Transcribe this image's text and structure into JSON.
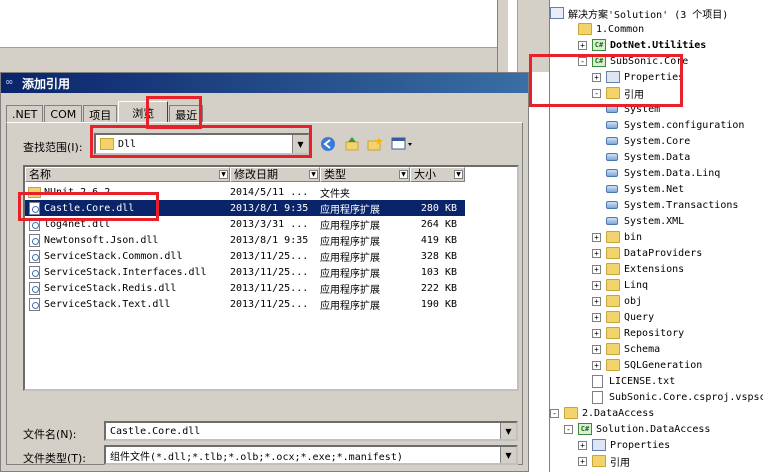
{
  "solution_explorer": {
    "root": "解决方案'Solution' (3 个项目)",
    "items": [
      {
        "label": "1.Common",
        "kind": "solution-folder",
        "expander": ""
      },
      {
        "label": "DotNet.Utilities",
        "kind": "project",
        "expander": "+"
      },
      {
        "label": "SubSonic.Core",
        "kind": "project",
        "expander": "-"
      },
      {
        "label": "Properties",
        "kind": "properties",
        "expander": "+"
      },
      {
        "label": "引用",
        "kind": "references-folder",
        "expander": "-"
      },
      {
        "label": "System",
        "kind": "reference"
      },
      {
        "label": "System.configuration",
        "kind": "reference"
      },
      {
        "label": "System.Core",
        "kind": "reference"
      },
      {
        "label": "System.Data",
        "kind": "reference"
      },
      {
        "label": "System.Data.Linq",
        "kind": "reference"
      },
      {
        "label": "System.Net",
        "kind": "reference"
      },
      {
        "label": "System.Transactions",
        "kind": "reference"
      },
      {
        "label": "System.XML",
        "kind": "reference"
      },
      {
        "label": "bin",
        "kind": "folder",
        "expander": "+"
      },
      {
        "label": "DataProviders",
        "kind": "folder",
        "expander": "+"
      },
      {
        "label": "Extensions",
        "kind": "folder",
        "expander": "+"
      },
      {
        "label": "Linq",
        "kind": "folder",
        "expander": "+"
      },
      {
        "label": "obj",
        "kind": "folder",
        "expander": "+"
      },
      {
        "label": "Query",
        "kind": "folder",
        "expander": "+"
      },
      {
        "label": "Repository",
        "kind": "folder",
        "expander": "+"
      },
      {
        "label": "Schema",
        "kind": "folder",
        "expander": "+"
      },
      {
        "label": "SQLGeneration",
        "kind": "folder",
        "expander": "+"
      },
      {
        "label": "LICENSE.txt",
        "kind": "file"
      },
      {
        "label": "SubSonic.Core.csproj.vspscc",
        "kind": "file"
      },
      {
        "label": "2.DataAccess",
        "kind": "solution-folder",
        "expander": "-"
      },
      {
        "label": "Solution.DataAccess",
        "kind": "project",
        "expander": "-"
      },
      {
        "label": "Properties",
        "kind": "properties",
        "expander": "+"
      },
      {
        "label": "引用",
        "kind": "references-folder",
        "expander": "+"
      }
    ]
  },
  "dialog": {
    "title": "添加引用",
    "tabs": [
      ".NET",
      "COM",
      "项目",
      "浏览",
      "最近"
    ],
    "active_tab": "浏览",
    "look_in_label": "查找范围(I):",
    "look_in_value": "Dll",
    "columns": [
      "名称",
      "修改日期",
      "类型",
      "大小"
    ],
    "files": [
      {
        "name": "NUnit.2.6.2",
        "date": "2014/5/11 ...",
        "type": "文件夹",
        "size": "",
        "kind": "folder"
      },
      {
        "name": "Castle.Core.dll",
        "date": "2013/8/1 9:35",
        "type": "应用程序扩展",
        "size": "280 KB",
        "kind": "dll",
        "selected": true
      },
      {
        "name": "log4net.dll",
        "date": "2013/3/31 ...",
        "type": "应用程序扩展",
        "size": "264 KB",
        "kind": "dll"
      },
      {
        "name": "Newtonsoft.Json.dll",
        "date": "2013/8/1 9:35",
        "type": "应用程序扩展",
        "size": "419 KB",
        "kind": "dll"
      },
      {
        "name": "ServiceStack.Common.dll",
        "date": "2013/11/25...",
        "type": "应用程序扩展",
        "size": "328 KB",
        "kind": "dll"
      },
      {
        "name": "ServiceStack.Interfaces.dll",
        "date": "2013/11/25...",
        "type": "应用程序扩展",
        "size": "103 KB",
        "kind": "dll"
      },
      {
        "name": "ServiceStack.Redis.dll",
        "date": "2013/11/25...",
        "type": "应用程序扩展",
        "size": "222 KB",
        "kind": "dll"
      },
      {
        "name": "ServiceStack.Text.dll",
        "date": "2013/11/25...",
        "type": "应用程序扩展",
        "size": "190 KB",
        "kind": "dll"
      }
    ],
    "filename_label": "文件名(N):",
    "filename_value": "Castle.Core.dll",
    "filetype_label": "文件类型(T):",
    "filetype_value": "组件文件(*.dll;*.tlb;*.olb;*.ocx;*.exe;*.manifest)",
    "toolbar_icons": [
      "back-icon",
      "up-folder-icon",
      "new-folder-icon",
      "view-menu-icon"
    ]
  },
  "colors": {
    "highlight": "#e8202a",
    "selection": "#0a246a",
    "titlebar": "#0a246a",
    "face": "#d4d0c8"
  }
}
